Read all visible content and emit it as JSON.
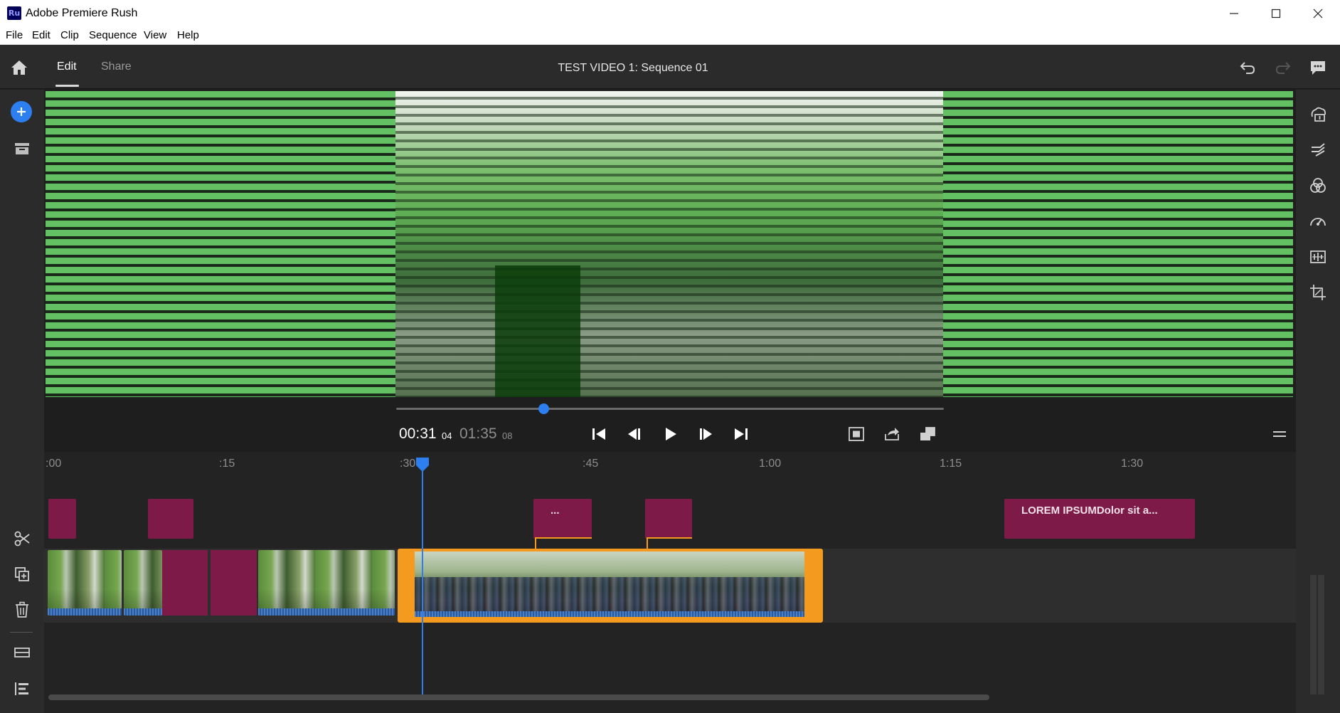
{
  "window": {
    "app_logo": "Ru",
    "title": "Adobe Premiere Rush",
    "controls": [
      "minimize",
      "maximize",
      "close"
    ]
  },
  "menu": [
    "File",
    "Edit",
    "Clip",
    "Sequence",
    "View",
    "Help"
  ],
  "header": {
    "tabs": [
      {
        "label": "Edit",
        "active": true
      },
      {
        "label": "Share",
        "active": false
      }
    ],
    "sequence_title": "TEST VIDEO 1: Sequence 01",
    "icons": [
      "home-icon",
      "undo-icon",
      "redo-icon",
      "feedback-icon"
    ]
  },
  "left_toolbar": {
    "top": [
      "add-media-icon",
      "project-media-icon"
    ],
    "bottom": [
      "split-icon",
      "duplicate-icon",
      "delete-icon",
      "track-icon",
      "track-list-icon"
    ],
    "accent": "#2d7ff0"
  },
  "right_toolbar": [
    "titles-icon",
    "transitions-icon",
    "color-icon",
    "speed-icon",
    "audio-icon",
    "transform-icon"
  ],
  "player": {
    "current_time": "00:31",
    "current_frames": "04",
    "total_time": "01:35",
    "total_frames": "08",
    "scrub_progress": 0.27,
    "transport": [
      "skip-to-start-icon",
      "step-back-icon",
      "play-icon",
      "step-forward-icon",
      "skip-to-end-icon"
    ],
    "view_controls": [
      "fit-icon",
      "share-frame-icon",
      "aspect-icon",
      "menu-icon"
    ]
  },
  "timeline": {
    "ruler": [
      ":00",
      ":15",
      ":30",
      ":45",
      "1:00",
      "1:15",
      "1:30"
    ],
    "title_clips": [
      {
        "label": ""
      },
      {
        "label": ""
      },
      {
        "label": "..."
      },
      {
        "label": ""
      },
      {
        "label": "LOREM IPSUMDolor sit a..."
      }
    ],
    "colors": {
      "title_clip": "#7e1a47",
      "selection": "#f39a1f",
      "playhead": "#2d7ff0",
      "audio_wave": "#4a7fc8",
      "audio_keyframe": "#c13ad4"
    }
  }
}
